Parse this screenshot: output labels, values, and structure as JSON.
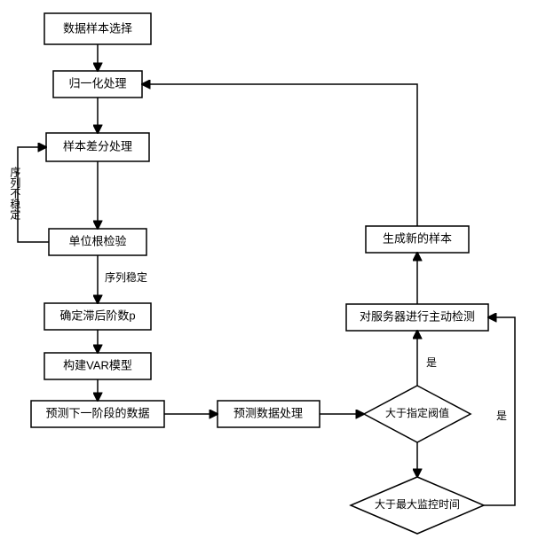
{
  "chart_data": {
    "type": "flowchart",
    "nodes": [
      {
        "id": "n1",
        "shape": "rect",
        "label": "数据样本选择"
      },
      {
        "id": "n2",
        "shape": "rect",
        "label": "归一化处理"
      },
      {
        "id": "n3",
        "shape": "rect",
        "label": "样本差分处理"
      },
      {
        "id": "n4",
        "shape": "rect",
        "label": "单位根检验"
      },
      {
        "id": "n5",
        "shape": "rect",
        "label": "确定滞后阶数p"
      },
      {
        "id": "n6",
        "shape": "rect",
        "label": "构建VAR模型"
      },
      {
        "id": "n7",
        "shape": "rect",
        "label": "预测下一阶段的数据"
      },
      {
        "id": "n8",
        "shape": "rect",
        "label": "预测数据处理"
      },
      {
        "id": "d1",
        "shape": "diamond",
        "label": "大于指定阀值"
      },
      {
        "id": "n9",
        "shape": "rect",
        "label": "对服务器进行主动检测"
      },
      {
        "id": "n10",
        "shape": "rect",
        "label": "生成新的样本"
      },
      {
        "id": "d2",
        "shape": "diamond",
        "label": "大于最大监控时间"
      }
    ],
    "edges": [
      {
        "from": "n1",
        "to": "n2"
      },
      {
        "from": "n2",
        "to": "n3"
      },
      {
        "from": "n3",
        "to": "n4"
      },
      {
        "from": "n4",
        "to": "n3",
        "label": "序列不稳定"
      },
      {
        "from": "n4",
        "to": "n5",
        "label": "序列稳定"
      },
      {
        "from": "n5",
        "to": "n6"
      },
      {
        "from": "n6",
        "to": "n7"
      },
      {
        "from": "n7",
        "to": "n8"
      },
      {
        "from": "n8",
        "to": "d1"
      },
      {
        "from": "d1",
        "to": "n9",
        "label": "是"
      },
      {
        "from": "n9",
        "to": "n10"
      },
      {
        "from": "n10",
        "to": "n2"
      },
      {
        "from": "d1",
        "to": "d2"
      },
      {
        "from": "d2",
        "to": "n9",
        "label": "是"
      }
    ]
  },
  "labels": {
    "n1": "数据样本选择",
    "n2": "归一化处理",
    "n3": "样本差分处理",
    "n4": "单位根检验",
    "n5": "确定滞后阶数p",
    "n6": "构建VAR模型",
    "n7": "预测下一阶段的数据",
    "n8": "预测数据处理",
    "n9": "对服务器进行主动检测",
    "n10": "生成新的样本",
    "d1": "大于指定阀值",
    "d2": "大于最大监控时间",
    "edge_unstable": "序列不稳定",
    "edge_stable": "序列稳定",
    "edge_yes1": "是",
    "edge_yes2": "是"
  }
}
